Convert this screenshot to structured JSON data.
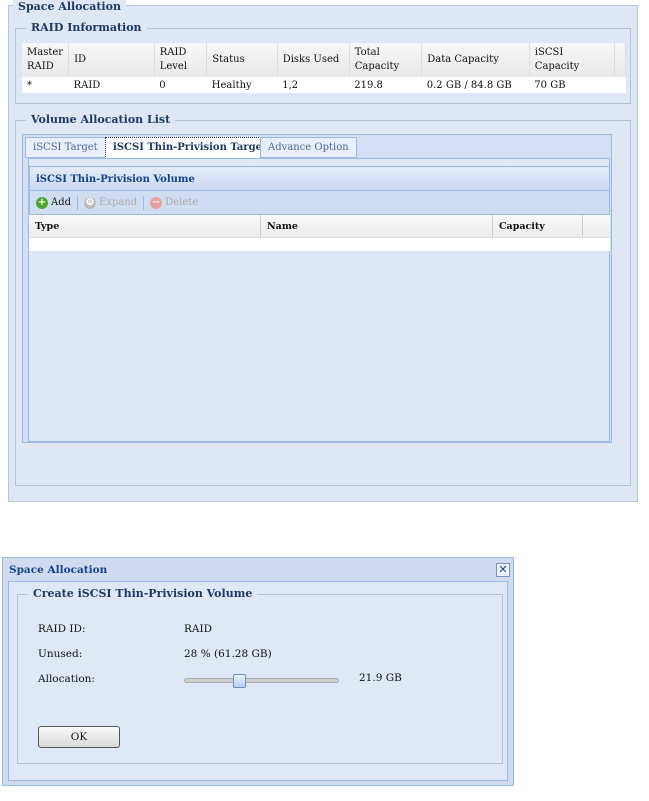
{
  "panel": {
    "title": "Space Allocation"
  },
  "raid_info": {
    "legend": "RAID Information",
    "headers": [
      "Master RAID",
      "ID",
      "RAID Level",
      "Status",
      "Disks Used",
      "Total Capacity",
      "Data Capacity",
      "iSCSI Capacity"
    ],
    "rows": [
      [
        "*",
        "RAID",
        "0",
        "Healthy",
        "1,2",
        "219.8",
        "0.2 GB / 84.8 GB",
        "70 GB"
      ]
    ]
  },
  "volume_list": {
    "legend": "Volume Allocation List",
    "tabs": [
      {
        "label": "iSCSI Target"
      },
      {
        "label": "iSCSI Thin-Privision Target"
      },
      {
        "label": "Advance Option"
      }
    ],
    "grid_title": "iSCSI Thin-Privision Volume",
    "toolbar": {
      "add": "Add",
      "expand": "Expand",
      "delete": "Delete"
    },
    "columns": [
      "Type",
      "Name",
      "Capacity"
    ]
  },
  "dialog": {
    "title": "Space Allocation",
    "legend": "Create iSCSI Thin-Privision Volume",
    "raid_id_label": "RAID ID:",
    "raid_id": "RAID",
    "unused_label": "Unused:",
    "unused": "28 % (61.28 GB)",
    "allocation_label": "Allocation:",
    "allocation": "21.9 GB",
    "slider_fraction": 0.35,
    "ok": "OK"
  }
}
